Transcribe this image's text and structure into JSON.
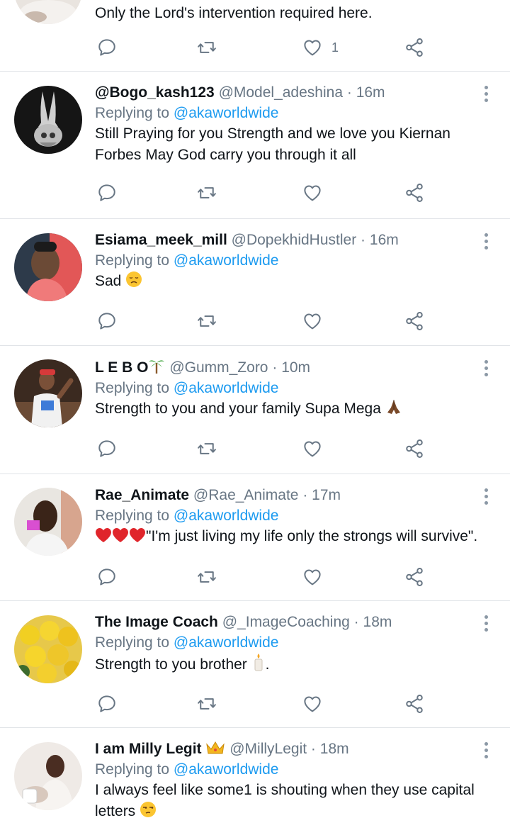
{
  "tweets": [
    {
      "id": "t0",
      "text": "Only the Lord's intervention required here.",
      "like_count": "1"
    },
    {
      "id": "t1",
      "name": "@Bogo_kash123",
      "handle": "@Model_adeshina",
      "time": "16m",
      "reply_prefix": "Replying to",
      "reply_to": "@akaworldwide",
      "text_line1": "Still Praying for you Strength and we love you Kiernan",
      "text_line2": "Forbes May God carry you through it all"
    },
    {
      "id": "t2",
      "name": "Esiama_meek_mill",
      "handle": "@DopekhidHustler",
      "time": "16m",
      "reply_prefix": "Replying to",
      "reply_to": "@akaworldwide",
      "text": "Sad",
      "emoji": "disappointed-face"
    },
    {
      "id": "t3",
      "name": "L E B O",
      "name_emoji": "palm-tree",
      "handle": "@Gumm_Zoro",
      "time": "10m",
      "reply_prefix": "Replying to",
      "reply_to": "@akaworldwide",
      "text": "Strength to you and your family Supa Mega",
      "emoji": "praying-hands"
    },
    {
      "id": "t4",
      "name": "Rae_Animate",
      "handle": "@Rae_Animate",
      "time": "17m",
      "reply_prefix": "Replying to",
      "reply_to": "@akaworldwide",
      "text": "\"I'm just living my life only the strongs will survive\".",
      "emoji": "three-red-hearts"
    },
    {
      "id": "t5",
      "name": "The Image Coach",
      "handle": "@_ImageCoaching",
      "time": "18m",
      "reply_prefix": "Replying to",
      "reply_to": "@akaworldwide",
      "text": "Strength to you brother",
      "text_suffix": ".",
      "emoji": "candle"
    },
    {
      "id": "t6",
      "name": "I am Milly Legit",
      "name_emoji": "crown",
      "handle": "@MillyLegit",
      "time": "18m",
      "reply_prefix": "Replying to",
      "reply_to": "@akaworldwide",
      "text_line1": "I always feel like some1 is shouting when they use capital",
      "text_line2": "letters",
      "emoji": "unamused-face"
    }
  ],
  "separator": "·",
  "colors": {
    "mention": "#1d9bf0",
    "secondary": "#687684",
    "border": "#e1e4e8",
    "icon": "#687684"
  }
}
